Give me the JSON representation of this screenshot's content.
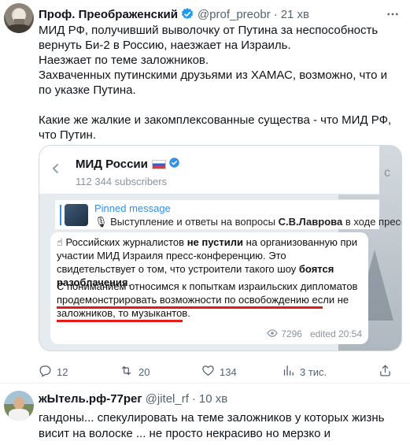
{
  "post": {
    "display_name": "Проф. Преображенский",
    "handle": "@prof_preobr",
    "separator": "·",
    "time": "21 хв",
    "paragraphs": [
      "МИД РФ, получивший выволочку от Путина за неспособность вернуть Би-2 в Россию, наезжает на Израиль.",
      "Наезжает по теме заложников.",
      "Захваченных путинскими друзьями из ХАМАС, возможно, что и по указке Путина.",
      "",
      "Какие же жалкие и закомплексованные существа - что МИД РФ, что Путин."
    ],
    "icons": {
      "verified": "verified-badge-icon",
      "more": "more-icon"
    }
  },
  "embed": {
    "channel_name": "МИД России",
    "subscribers": "112 344 subscribers",
    "corner_char": "с",
    "pinned_title": "Pinned message",
    "pinned_prefix": "Выступление и ответы на вопросы ",
    "pinned_bold": "С.В.Лаврова",
    "pinned_suffix": " в ходе пресс-конфе",
    "msg_p1": [
      "☝ Российских журналистов ",
      "не пустили",
      " на организованную при участии МИД Израиля пресс-конференцию. Это свидетельствует о том, что устроители такого шоу ",
      "боятся разоблачения",
      "."
    ],
    "msg_p2": "С пониманием относимся к попыткам израильских дипломатов продемонстрировать возможности по освобождению если не заложников, то музыкантов.",
    "views": "7296",
    "edited": "edited 20:54"
  },
  "actions": {
    "reply": "12",
    "retweet": "20",
    "like": "134",
    "views": "3 тис."
  },
  "reply": {
    "display_name": "жЫтель.рф-77рег",
    "handle": "@jitel_rf",
    "separator": "·",
    "time": "10 хв",
    "text": "гандоны... спекулировать на теме заложников у которых жизнь висит на волоске ... не просто некрасиво но мерзко и отвратительно ...."
  },
  "colors": {
    "accent": "#1d9bf0",
    "telegram": "#3390ec",
    "underline": "#e31b1b",
    "muted": "#536471"
  }
}
